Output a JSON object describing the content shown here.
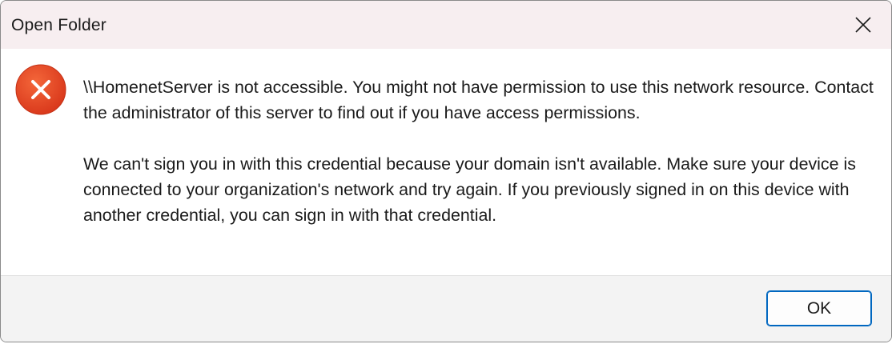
{
  "window": {
    "title": "Open Folder"
  },
  "icons": {
    "close": "close-icon",
    "status": "error-icon"
  },
  "colors": {
    "error_icon": "#e8421c",
    "titlebar_bg": "#f7eef0",
    "button_accent": "#0067c0",
    "footer_bg": "#f3f3f3"
  },
  "message": {
    "paragraph1": "\\\\HomenetServer is not accessible. You might not have permission to use this network resource. Contact the administrator of this server to find out if you have access permissions.",
    "paragraph2": "We can't sign you in with this credential because your domain isn't available. Make sure your device is connected to your organization's network and try again. If you previously signed in on this device with another credential, you can sign in with that credential."
  },
  "buttons": {
    "ok_label": "OK"
  }
}
